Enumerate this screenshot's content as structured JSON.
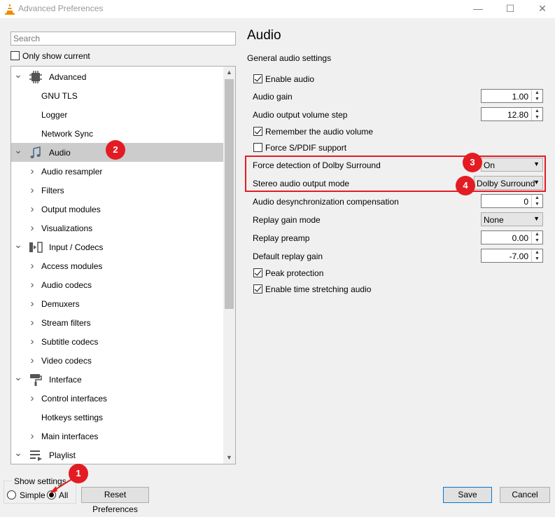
{
  "window": {
    "title": "Advanced Preferences"
  },
  "search": {
    "placeholder": "Search",
    "value": ""
  },
  "only_show_current": {
    "label": "Only show current",
    "checked": false
  },
  "tree": {
    "items": [
      {
        "label": "Advanced",
        "level": 0,
        "expanded": true,
        "icon": "chip-icon"
      },
      {
        "label": "GNU TLS",
        "level": 1
      },
      {
        "label": "Logger",
        "level": 1
      },
      {
        "label": "Network Sync",
        "level": 1
      },
      {
        "label": "Audio",
        "level": 0,
        "expanded": true,
        "selected": true,
        "icon": "music-note-icon"
      },
      {
        "label": "Audio resampler",
        "level": 1,
        "has_children": true
      },
      {
        "label": "Filters",
        "level": 1,
        "has_children": true
      },
      {
        "label": "Output modules",
        "level": 1,
        "has_children": true
      },
      {
        "label": "Visualizations",
        "level": 1,
        "has_children": true
      },
      {
        "label": "Input / Codecs",
        "level": 0,
        "expanded": true,
        "icon": "input-codecs-icon"
      },
      {
        "label": "Access modules",
        "level": 1,
        "has_children": true
      },
      {
        "label": "Audio codecs",
        "level": 1,
        "has_children": true
      },
      {
        "label": "Demuxers",
        "level": 1,
        "has_children": true
      },
      {
        "label": "Stream filters",
        "level": 1,
        "has_children": true
      },
      {
        "label": "Subtitle codecs",
        "level": 1,
        "has_children": true
      },
      {
        "label": "Video codecs",
        "level": 1,
        "has_children": true
      },
      {
        "label": "Interface",
        "level": 0,
        "expanded": true,
        "icon": "paint-roller-icon"
      },
      {
        "label": "Control interfaces",
        "level": 1,
        "has_children": true
      },
      {
        "label": "Hotkeys settings",
        "level": 1
      },
      {
        "label": "Main interfaces",
        "level": 1,
        "has_children": true
      },
      {
        "label": "Playlist",
        "level": 0,
        "expanded": true,
        "icon": "playlist-icon"
      }
    ]
  },
  "panel": {
    "title": "Audio",
    "subtitle": "General audio settings",
    "enable_audio": {
      "label": "Enable audio",
      "checked": true
    },
    "audio_gain": {
      "label": "Audio gain",
      "value": "1.00"
    },
    "volume_step": {
      "label": "Audio output volume step",
      "value": "12.80"
    },
    "remember_volume": {
      "label": "Remember the audio volume",
      "checked": true
    },
    "force_spdif": {
      "label": "Force S/PDIF support",
      "checked": false
    },
    "dolby_detection": {
      "label": "Force detection of Dolby Surround",
      "value": "On"
    },
    "stereo_mode": {
      "label": "Stereo audio output mode",
      "value": "Dolby Surround"
    },
    "desync": {
      "label": "Audio desynchronization compensation",
      "value": "0"
    },
    "replay_gain_mode": {
      "label": "Replay gain mode",
      "value": "None"
    },
    "replay_preamp": {
      "label": "Replay preamp",
      "value": "0.00"
    },
    "default_replay_gain": {
      "label": "Default replay gain",
      "value": "-7.00"
    },
    "peak_protection": {
      "label": "Peak protection",
      "checked": true
    },
    "time_stretching": {
      "label": "Enable time stretching audio",
      "checked": true
    }
  },
  "badges": {
    "b1": "1",
    "b2": "2",
    "b3": "3",
    "b4": "4"
  },
  "show_settings": {
    "label": "Show settings",
    "simple_label": "Simple",
    "all_label": "All",
    "selected": "All"
  },
  "buttons": {
    "reset": "Reset Preferences",
    "save": "Save",
    "cancel": "Cancel"
  },
  "colors": {
    "annotation_red": "#e31c23",
    "selected_row": "#cccccc",
    "accent_border": "#0078d7"
  }
}
